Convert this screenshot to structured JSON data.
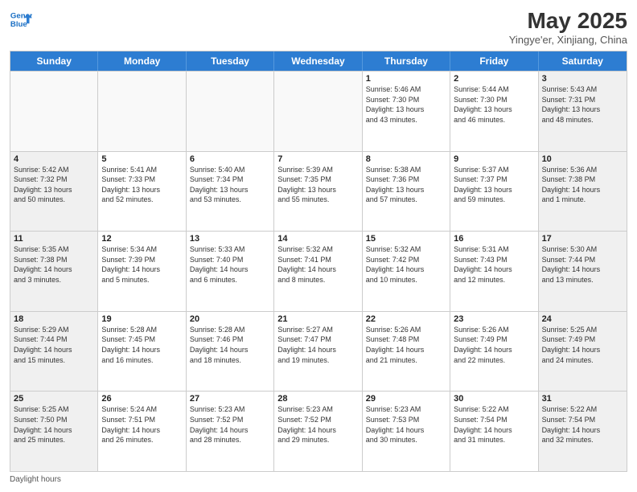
{
  "logo": {
    "line1": "General",
    "line2": "Blue"
  },
  "title": "May 2025",
  "subtitle": "Yingye'er, Xinjiang, China",
  "days": [
    "Sunday",
    "Monday",
    "Tuesday",
    "Wednesday",
    "Thursday",
    "Friday",
    "Saturday"
  ],
  "weeks": [
    [
      {
        "num": "",
        "info": ""
      },
      {
        "num": "",
        "info": ""
      },
      {
        "num": "",
        "info": ""
      },
      {
        "num": "",
        "info": ""
      },
      {
        "num": "1",
        "info": "Sunrise: 5:46 AM\nSunset: 7:30 PM\nDaylight: 13 hours\nand 43 minutes."
      },
      {
        "num": "2",
        "info": "Sunrise: 5:44 AM\nSunset: 7:30 PM\nDaylight: 13 hours\nand 46 minutes."
      },
      {
        "num": "3",
        "info": "Sunrise: 5:43 AM\nSunset: 7:31 PM\nDaylight: 13 hours\nand 48 minutes."
      }
    ],
    [
      {
        "num": "4",
        "info": "Sunrise: 5:42 AM\nSunset: 7:32 PM\nDaylight: 13 hours\nand 50 minutes."
      },
      {
        "num": "5",
        "info": "Sunrise: 5:41 AM\nSunset: 7:33 PM\nDaylight: 13 hours\nand 52 minutes."
      },
      {
        "num": "6",
        "info": "Sunrise: 5:40 AM\nSunset: 7:34 PM\nDaylight: 13 hours\nand 53 minutes."
      },
      {
        "num": "7",
        "info": "Sunrise: 5:39 AM\nSunset: 7:35 PM\nDaylight: 13 hours\nand 55 minutes."
      },
      {
        "num": "8",
        "info": "Sunrise: 5:38 AM\nSunset: 7:36 PM\nDaylight: 13 hours\nand 57 minutes."
      },
      {
        "num": "9",
        "info": "Sunrise: 5:37 AM\nSunset: 7:37 PM\nDaylight: 13 hours\nand 59 minutes."
      },
      {
        "num": "10",
        "info": "Sunrise: 5:36 AM\nSunset: 7:38 PM\nDaylight: 14 hours\nand 1 minute."
      }
    ],
    [
      {
        "num": "11",
        "info": "Sunrise: 5:35 AM\nSunset: 7:38 PM\nDaylight: 14 hours\nand 3 minutes."
      },
      {
        "num": "12",
        "info": "Sunrise: 5:34 AM\nSunset: 7:39 PM\nDaylight: 14 hours\nand 5 minutes."
      },
      {
        "num": "13",
        "info": "Sunrise: 5:33 AM\nSunset: 7:40 PM\nDaylight: 14 hours\nand 6 minutes."
      },
      {
        "num": "14",
        "info": "Sunrise: 5:32 AM\nSunset: 7:41 PM\nDaylight: 14 hours\nand 8 minutes."
      },
      {
        "num": "15",
        "info": "Sunrise: 5:32 AM\nSunset: 7:42 PM\nDaylight: 14 hours\nand 10 minutes."
      },
      {
        "num": "16",
        "info": "Sunrise: 5:31 AM\nSunset: 7:43 PM\nDaylight: 14 hours\nand 12 minutes."
      },
      {
        "num": "17",
        "info": "Sunrise: 5:30 AM\nSunset: 7:44 PM\nDaylight: 14 hours\nand 13 minutes."
      }
    ],
    [
      {
        "num": "18",
        "info": "Sunrise: 5:29 AM\nSunset: 7:44 PM\nDaylight: 14 hours\nand 15 minutes."
      },
      {
        "num": "19",
        "info": "Sunrise: 5:28 AM\nSunset: 7:45 PM\nDaylight: 14 hours\nand 16 minutes."
      },
      {
        "num": "20",
        "info": "Sunrise: 5:28 AM\nSunset: 7:46 PM\nDaylight: 14 hours\nand 18 minutes."
      },
      {
        "num": "21",
        "info": "Sunrise: 5:27 AM\nSunset: 7:47 PM\nDaylight: 14 hours\nand 19 minutes."
      },
      {
        "num": "22",
        "info": "Sunrise: 5:26 AM\nSunset: 7:48 PM\nDaylight: 14 hours\nand 21 minutes."
      },
      {
        "num": "23",
        "info": "Sunrise: 5:26 AM\nSunset: 7:49 PM\nDaylight: 14 hours\nand 22 minutes."
      },
      {
        "num": "24",
        "info": "Sunrise: 5:25 AM\nSunset: 7:49 PM\nDaylight: 14 hours\nand 24 minutes."
      }
    ],
    [
      {
        "num": "25",
        "info": "Sunrise: 5:25 AM\nSunset: 7:50 PM\nDaylight: 14 hours\nand 25 minutes."
      },
      {
        "num": "26",
        "info": "Sunrise: 5:24 AM\nSunset: 7:51 PM\nDaylight: 14 hours\nand 26 minutes."
      },
      {
        "num": "27",
        "info": "Sunrise: 5:23 AM\nSunset: 7:52 PM\nDaylight: 14 hours\nand 28 minutes."
      },
      {
        "num": "28",
        "info": "Sunrise: 5:23 AM\nSunset: 7:52 PM\nDaylight: 14 hours\nand 29 minutes."
      },
      {
        "num": "29",
        "info": "Sunrise: 5:23 AM\nSunset: 7:53 PM\nDaylight: 14 hours\nand 30 minutes."
      },
      {
        "num": "30",
        "info": "Sunrise: 5:22 AM\nSunset: 7:54 PM\nDaylight: 14 hours\nand 31 minutes."
      },
      {
        "num": "31",
        "info": "Sunrise: 5:22 AM\nSunset: 7:54 PM\nDaylight: 14 hours\nand 32 minutes."
      }
    ]
  ],
  "footer": "Daylight hours"
}
